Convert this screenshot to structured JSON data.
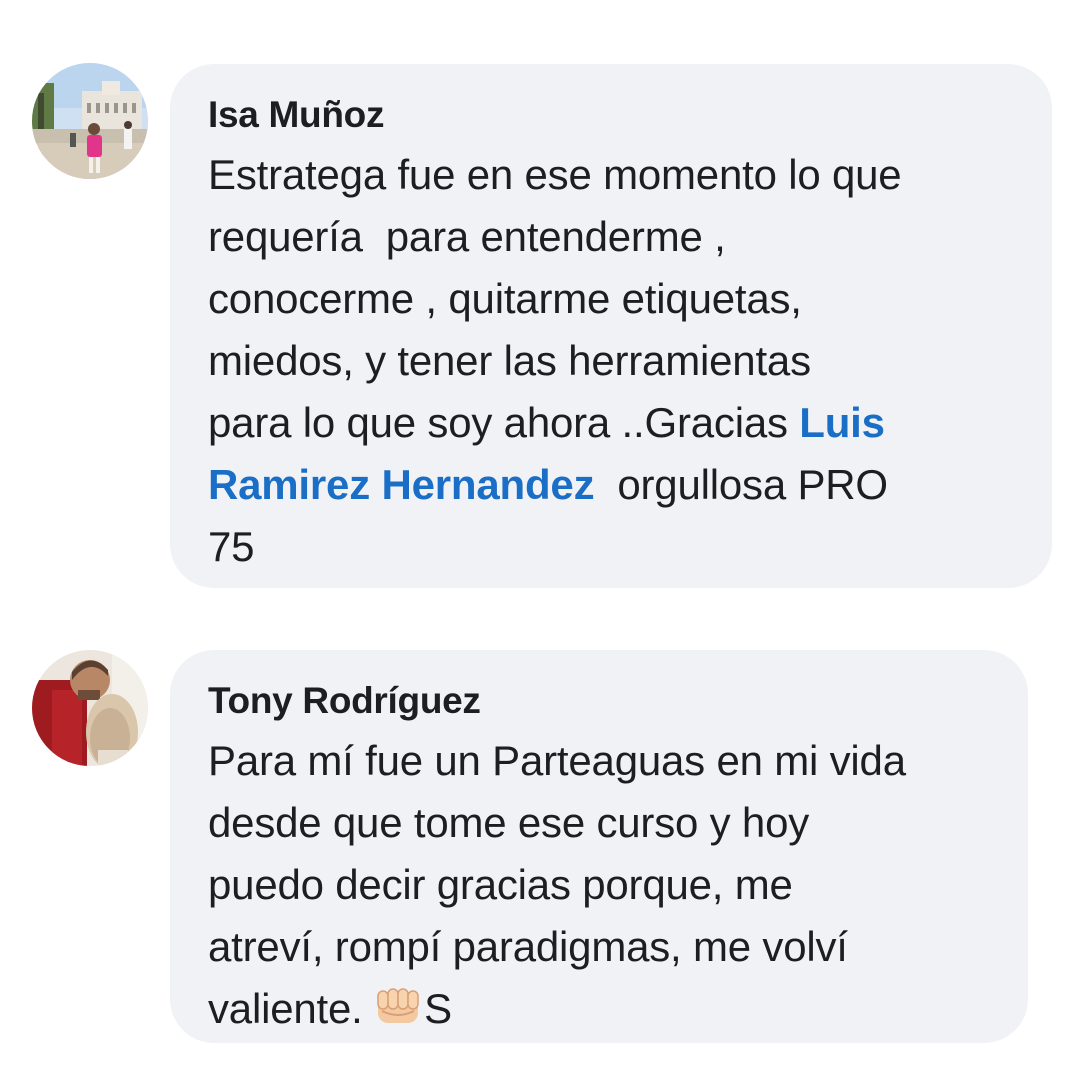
{
  "comments": [
    {
      "author": "Isa Muñoz",
      "text_before": "Estratega fue en ese momento lo que\nrequería  para entenderme ,\nconocerme , quitarme etiquetas,\nmiedos, y tener las herramientas\npara lo que soy ahora ..Gracias ",
      "mention": "Luis\nRamirez Hernandez",
      "text_after": "  orgullosa PRO\n75"
    },
    {
      "author": "Tony Rodríguez",
      "text": "Para mí fue un Parteaguas en mi vida\ndesde que tome ese curso y hoy\npuedo decir gracias porque, me\natreví, rompí paradigmas, me volví\nvaliente. ",
      "emoji": "oncoming-fist",
      "text_after_emoji": "S"
    }
  ],
  "colors": {
    "bubble": "#f0f2f5",
    "text": "#1c1e21",
    "mention": "#1b6ec6"
  }
}
